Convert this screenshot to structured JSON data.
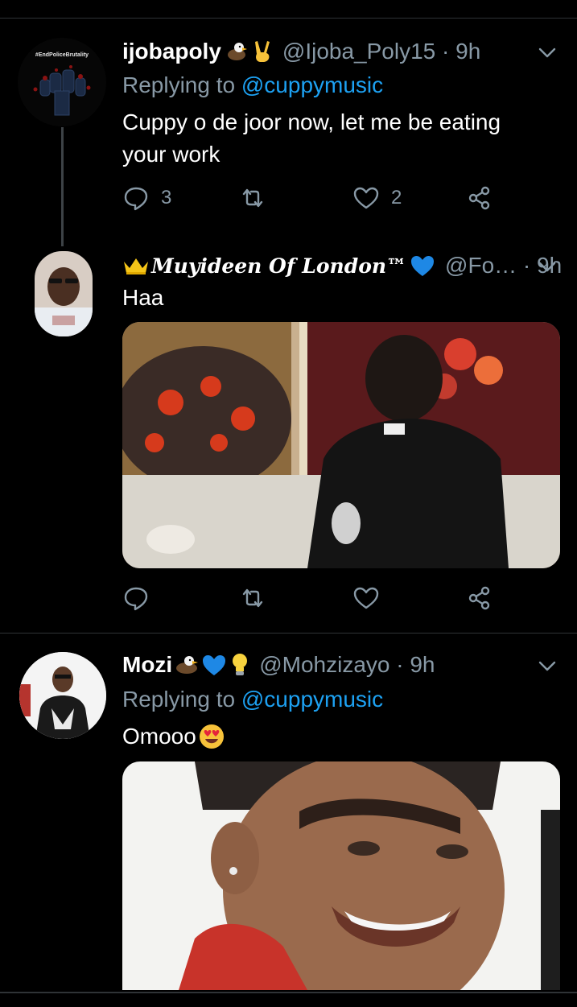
{
  "tweets": [
    {
      "name": "ijobapoly",
      "handle": "@Ijoba_Poly15",
      "time": "9h",
      "meta": "@Ijoba_Poly15 · 9h",
      "replying_prefix": "Replying to ",
      "replying_to": "@cuppymusic",
      "text_line1": "Cuppy o de joor now, let me be eating",
      "text_line2": "your work",
      "reply_count": "3",
      "retweet_count": "",
      "like_count": "2",
      "avatar_banner": "#EndPoliceBrutality"
    },
    {
      "name": "Muyideen Of London™",
      "meta": "@Fo… · 9h",
      "text": "Haa",
      "reply_count": "",
      "retweet_count": "",
      "like_count": ""
    },
    {
      "name": "Mozi",
      "meta": "@Mohzizayo · 9h",
      "replying_prefix": "Replying to ",
      "replying_to": "@cuppymusic",
      "text": "Omooo"
    }
  ],
  "icons": [
    "chevron-down-icon",
    "reply-icon",
    "retweet-icon",
    "like-icon",
    "share-icon",
    "eagle-emoji",
    "victory-hand-emoji",
    "crown-emoji",
    "blue-heart-emoji",
    "light-bulb-emoji",
    "heart-eyes-emoji"
  ],
  "colors": {
    "background": "#000000",
    "text": "#ffffff",
    "secondary": "#8899a6",
    "accent": "#1da1f2",
    "divider": "#2f3336"
  }
}
